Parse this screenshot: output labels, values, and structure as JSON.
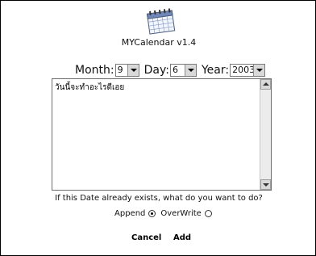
{
  "app": {
    "title": "MYCalendar v1.4",
    "logo_icon": "calendar-icon"
  },
  "date": {
    "month_label": "Month:",
    "month_value": "9",
    "day_label": "Day:",
    "day_value": "6",
    "year_label": "Year:",
    "year_value": "2003"
  },
  "note": {
    "text": "วันนี้จะทำอะไรดีเอย"
  },
  "conflict": {
    "question": "If this Date already exists, what do you want to do?",
    "append_label": "Append",
    "overwrite_label": "OverWrite",
    "selected": "Append"
  },
  "actions": {
    "cancel_label": "Cancel",
    "add_label": "Add"
  }
}
